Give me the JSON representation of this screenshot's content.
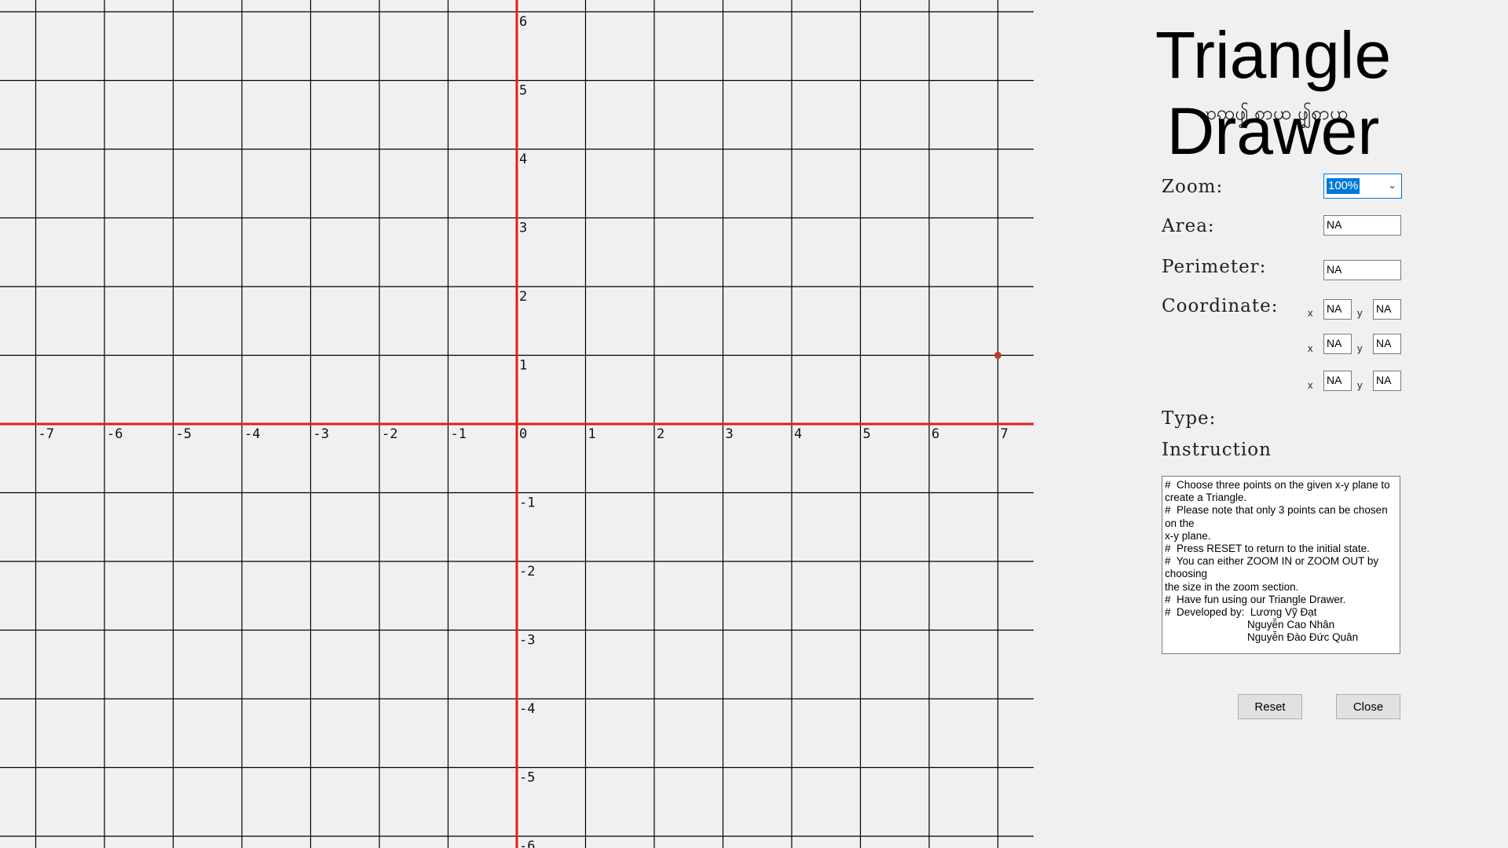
{
  "app": {
    "title": "Triangle Drawer",
    "subtitle": "ꩤꩡꩴ ꩱꩤ ꩴꩱꩤ"
  },
  "plane": {
    "x_range": [
      -7,
      7
    ],
    "y_range": [
      -6,
      6
    ],
    "x_ticks": [
      "-7",
      "-6",
      "-5",
      "-4",
      "-3",
      "-2",
      "-1",
      "0",
      "1",
      "2",
      "3",
      "4",
      "5",
      "6",
      "7"
    ],
    "y_ticks": [
      "6",
      "5",
      "4",
      "3",
      "2",
      "1",
      "-1",
      "-2",
      "-3",
      "-4",
      "-5",
      "-6"
    ],
    "axis_color": "#e11d1d",
    "grid_color": "#000000",
    "marker": {
      "x": 7,
      "y": 1,
      "color": "#c0392b"
    }
  },
  "labels": {
    "zoom": "Zoom:",
    "area": "Area:",
    "perimeter": "Perimeter:",
    "coordinate": "Coordinate:",
    "type": "Type:",
    "instruction": "Instruction"
  },
  "zoom": {
    "selected": "100%"
  },
  "values": {
    "area": "NA",
    "perimeter": "NA"
  },
  "coordinates": [
    {
      "x_label": "x",
      "x": "NA",
      "y_label": "y",
      "y": "NA"
    },
    {
      "x_label": "x",
      "x": "NA",
      "y_label": "y",
      "y": "NA"
    },
    {
      "x_label": "x",
      "x": "NA",
      "y_label": "y",
      "y": "NA"
    }
  ],
  "instruction_text": "#  Choose three points on the given x-y plane to create a Triangle.\n#  Please note that only 3 points can be chosen on the\nx-y plane.\n#  Press RESET to return to the initial state.\n#  You can either ZOOM IN or ZOOM OUT by choosing\nthe size in the zoom section.\n#  Have fun using our Triangle Drawer.\n#  Developed by:  Lương Vỹ Đạt\n                            Nguyễn Cao Nhân\n                            Nguyễn Đào Đức Quân",
  "buttons": {
    "reset": "Reset",
    "close": "Close"
  }
}
